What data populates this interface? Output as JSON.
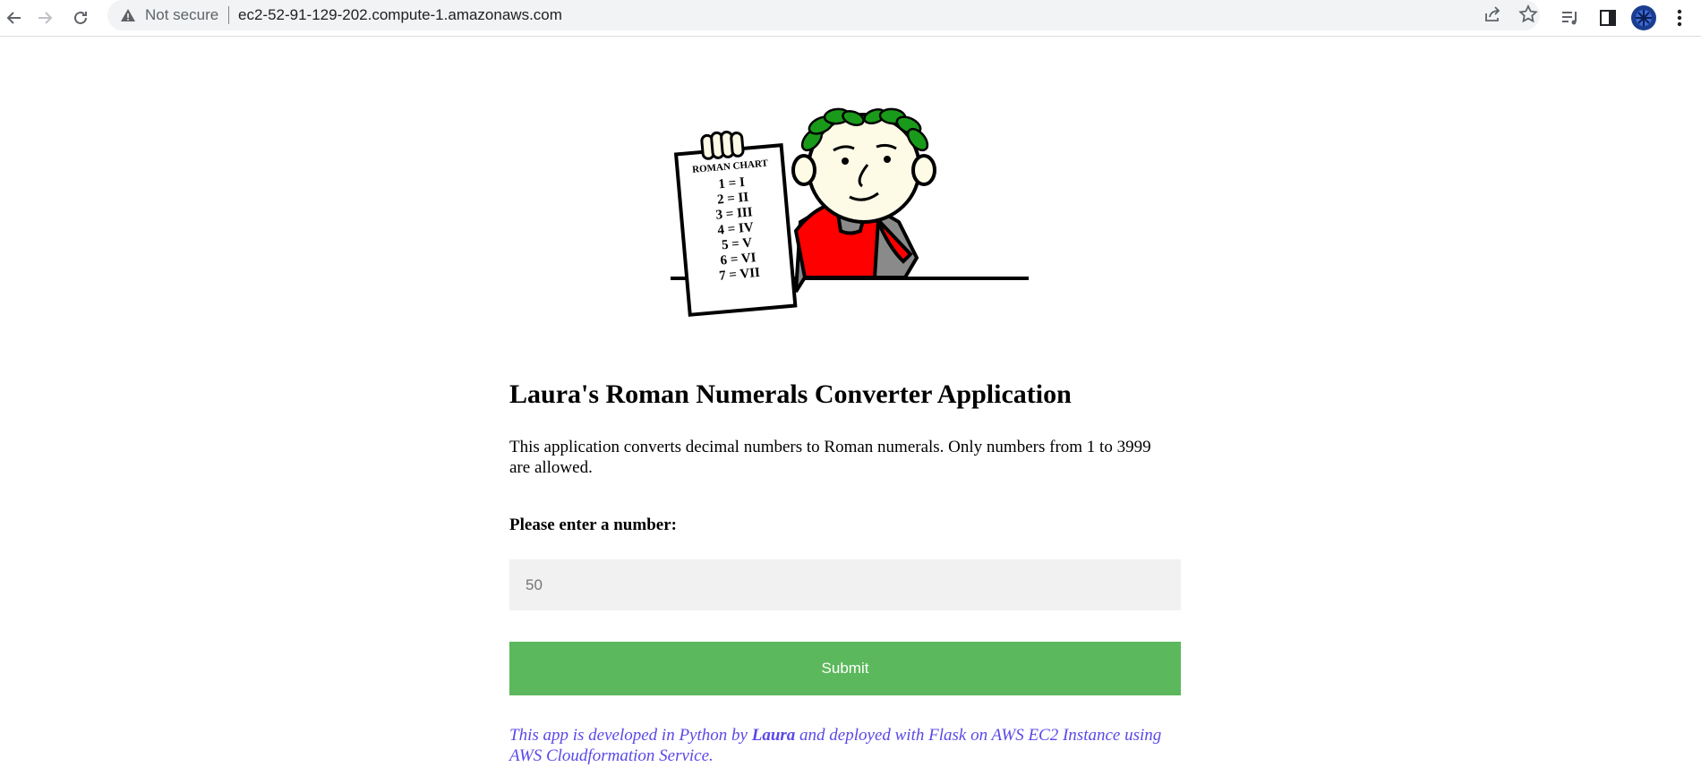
{
  "browser": {
    "security_status": "Not secure",
    "url": "ec2-52-91-129-202.compute-1.amazonaws.com"
  },
  "hero": {
    "chart_heading": "ROMAN CHART",
    "chart_rows": [
      "1 = I",
      "2 = II",
      "3 = III",
      "4 = IV",
      "5 = V",
      "6 = VI",
      "7 = VII"
    ],
    "colors": {
      "laurel": "#1a9a1a",
      "toga": "#ff0000",
      "tunic": "#8a8a8a",
      "skin": "#fdfbe6"
    }
  },
  "page": {
    "title": "Laura's Roman Numerals Converter Application",
    "description": "This application converts decimal numbers to Roman numerals. Only numbers from 1 to 3999 are allowed.",
    "input_label": "Please enter a number:",
    "input_placeholder": "50",
    "submit_label": "Submit",
    "footer_prefix": "This app is developed in Python by ",
    "footer_author": "Laura",
    "footer_suffix": " and deployed with Flask on AWS EC2 Instance using AWS Cloudformation Service.",
    "colors": {
      "submit_bg": "#5cb85c",
      "footer_text": "#5a48e8",
      "input_bg": "#f1f1f1"
    }
  }
}
